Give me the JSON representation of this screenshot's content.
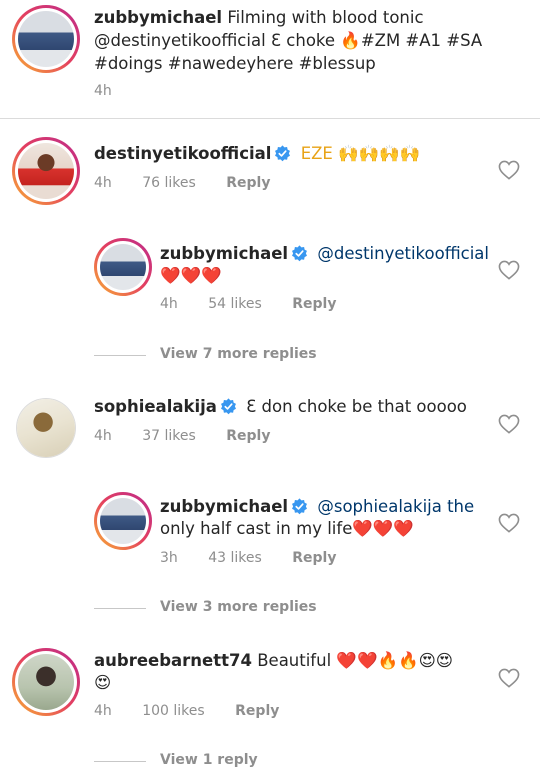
{
  "caption": {
    "username": "zubbymichael",
    "text_1": "Filming with blood tonic",
    "text_2": "@destinyetikoofficial Ɛ choke 🔥#ZM #A1 #SA",
    "text_3": "#doings #nawedeyhere #blessup",
    "time": "4h"
  },
  "comments": [
    {
      "username": "destinyetikoofficial",
      "text": "EZE 🙌🙌🙌🙌",
      "time": "4h",
      "likes": "76 likes",
      "reply": "Reply",
      "reply_item": {
        "username": "zubbymichael",
        "text": "@destinyetikoofficial",
        "text_2": "❤️❤️❤️",
        "time": "4h",
        "likes": "54 likes",
        "reply": "Reply"
      },
      "view_more": "View 7 more replies"
    },
    {
      "username": "sophiealakija",
      "text": "Ɛ don choke be that ooooo",
      "time": "4h",
      "likes": "37 likes",
      "reply": "Reply",
      "reply_item": {
        "username": "zubbymichael",
        "text": "@sophiealakija the",
        "text_2": "only half cast in my life❤️❤️❤️",
        "time": "3h",
        "likes": "43 likes",
        "reply": "Reply"
      },
      "view_more": "View 3 more replies"
    },
    {
      "username": "aubreebarnett74",
      "text": "Beautiful ❤️❤️🔥🔥😍😍",
      "text_2": "😍",
      "time": "4h",
      "likes": "100 likes",
      "reply": "Reply",
      "view_more": "View 1 reply"
    }
  ],
  "colors": {
    "verified": "#3897f0",
    "muted": "#8e8e8e",
    "text": "#262626",
    "heart": "#d9161c"
  }
}
